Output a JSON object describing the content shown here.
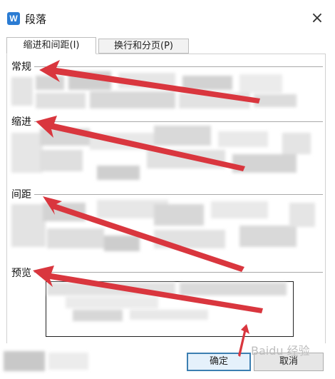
{
  "dialog": {
    "title": "段落",
    "app_icon_glyph": "W",
    "close_icon": "×"
  },
  "tabs": [
    {
      "label": "缩进和间距(I)",
      "active": true
    },
    {
      "label": "换行和分页(P)",
      "active": false
    }
  ],
  "sections": {
    "general": "常规",
    "indent": "缩进",
    "spacing": "间距",
    "preview": "预览"
  },
  "buttons": {
    "ok": "确定",
    "cancel": "取消"
  },
  "watermark": "Baidu 经验",
  "colors": {
    "arrow": "#d9363e",
    "accent": "#2b7cd3"
  }
}
